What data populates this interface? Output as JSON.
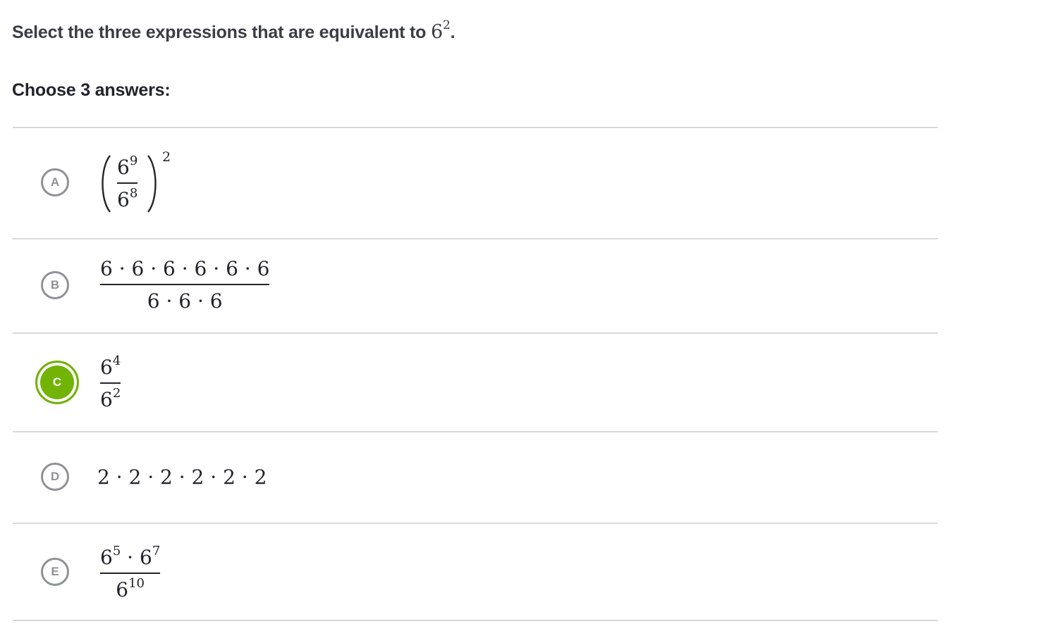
{
  "question": {
    "prefix": "Select the three expressions that are equivalent to ",
    "base": "6",
    "exponent": "2",
    "suffix": "."
  },
  "instruction": "Choose 3 answers:",
  "choices": [
    {
      "letter": "A",
      "selected": false,
      "numerator": "6",
      "numerator_exp": "9",
      "denominator": "6",
      "denominator_exp": "8",
      "outer_exp": "2"
    },
    {
      "letter": "B",
      "selected": false,
      "numerator": "6 · 6 · 6 · 6 · 6 · 6",
      "denominator": "6 · 6 · 6"
    },
    {
      "letter": "C",
      "selected": true,
      "numerator": "6",
      "numerator_exp": "4",
      "denominator": "6",
      "denominator_exp": "2"
    },
    {
      "letter": "D",
      "selected": false,
      "expression": "2 · 2 · 2 · 2 · 2 · 2"
    },
    {
      "letter": "E",
      "selected": false,
      "numerator_a": "6",
      "numerator_a_exp": "5",
      "numerator_op": " · ",
      "numerator_b": "6",
      "numerator_b_exp": "7",
      "denominator": "6",
      "denominator_exp": "10"
    }
  ],
  "colors": {
    "selected": "#71b307",
    "unselected": "#8e9196",
    "divider": "#d6d8da"
  }
}
